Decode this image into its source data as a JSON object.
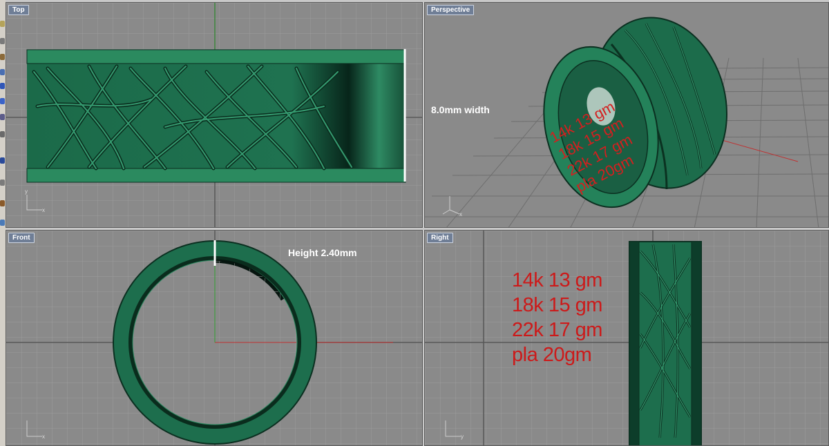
{
  "viewports": {
    "top": {
      "label": "Top"
    },
    "perspective": {
      "label": "Perspective"
    },
    "front": {
      "label": "Front"
    },
    "right": {
      "label": "Right"
    }
  },
  "annotations": {
    "width": "8.0mm width",
    "height": "Height 2.40mm",
    "weights": [
      "14k 13 gm",
      "18k 15 gm",
      "22k 17 gm",
      "pla 20gm"
    ]
  },
  "colors": {
    "ring_green": "#1d6e4d",
    "ring_dark": "#0b2f20",
    "grid_bg": "#8a8a8a",
    "axis_red": "#c03030",
    "axis_green": "#30a030",
    "weight_red": "#cc1a1a",
    "tab_bg": "#6f7e96"
  },
  "icons": [
    "axis-gizmo-icon",
    "toolbar-tool-icon"
  ]
}
